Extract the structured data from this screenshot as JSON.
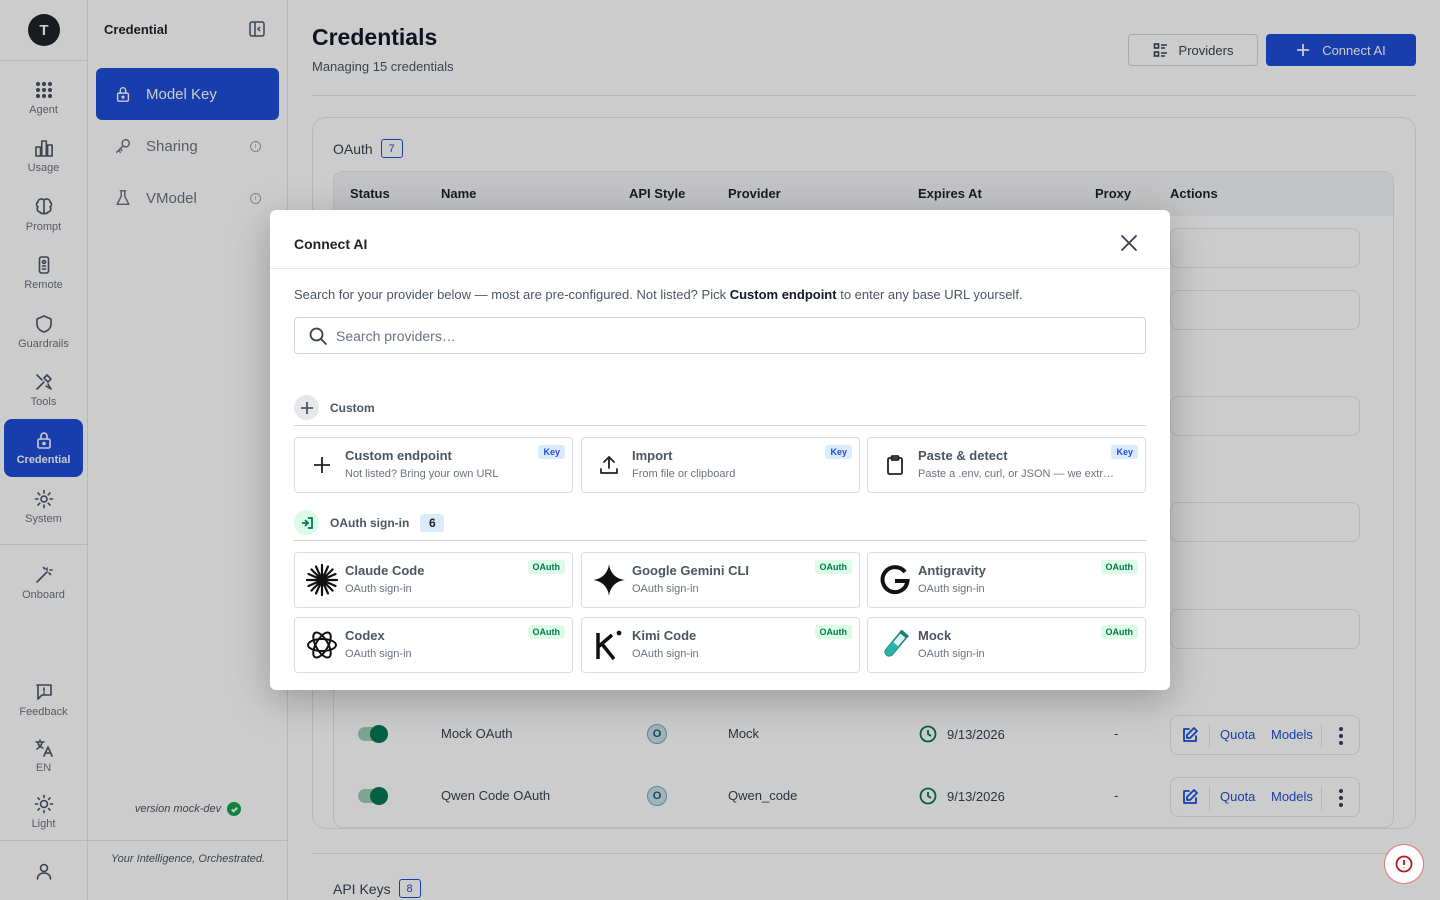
{
  "app": {
    "logo_letter": "T"
  },
  "rail": {
    "items": [
      {
        "label": "Agent",
        "icon": "agent-grid-icon"
      },
      {
        "label": "Usage",
        "icon": "bar-chart-icon"
      },
      {
        "label": "Prompt",
        "icon": "brain-icon"
      },
      {
        "label": "Remote",
        "icon": "remote-icon"
      },
      {
        "label": "Guardrails",
        "icon": "shield-icon"
      },
      {
        "label": "Tools",
        "icon": "tools-icon"
      },
      {
        "label": "Credential",
        "icon": "lock-icon",
        "active": true
      },
      {
        "label": "System",
        "icon": "gear-icon"
      },
      {
        "label": "Onboard",
        "icon": "magic-wand-icon"
      }
    ],
    "bottom": [
      {
        "label": "Feedback",
        "icon": "feedback-icon"
      },
      {
        "label": "EN",
        "icon": "translate-icon"
      },
      {
        "label": "Light",
        "icon": "sun-icon"
      }
    ]
  },
  "sidebar": {
    "title": "Credential",
    "items": [
      {
        "label": "Model Key",
        "icon": "lock-icon",
        "active": true
      },
      {
        "label": "Sharing",
        "icon": "key-icon"
      },
      {
        "label": "VModel",
        "icon": "flask-icon"
      }
    ],
    "version": "version mock-dev",
    "tagline": "Your Intelligence, Orchestrated."
  },
  "main": {
    "title": "Credentials",
    "subtitle": "Managing 15 credentials",
    "providers_label": "Providers",
    "connect_label": "Connect AI",
    "oauth_section": {
      "label": "OAuth",
      "count": "7"
    },
    "api_section": {
      "label": "API Keys",
      "count": "8"
    },
    "columns": [
      "Status",
      "Name",
      "API Style",
      "Provider",
      "Expires At",
      "Proxy",
      "Actions"
    ],
    "rows": [
      {
        "name": "Mock OAuth",
        "api_style": "O",
        "provider": "Mock",
        "expires": "9/13/2026",
        "proxy": "-"
      },
      {
        "name": "Qwen Code OAuth",
        "api_style": "O",
        "provider": "Qwen_code",
        "expires": "9/13/2026",
        "proxy": "-"
      }
    ],
    "action_labels": {
      "quota": "Quota",
      "models": "Models"
    }
  },
  "modal": {
    "title": "Connect AI",
    "desc_prefix": "Search for your provider below — most are pre-configured. Not listed? Pick ",
    "desc_bold": "Custom endpoint",
    "desc_suffix": " to enter any base URL yourself.",
    "search_placeholder": "Search providers…",
    "custom_group": {
      "label": "Custom",
      "cards": [
        {
          "name": "Custom endpoint",
          "sub": "Not listed? Bring your own URL",
          "badge": "Key",
          "icon": "plus-icon"
        },
        {
          "name": "Import",
          "sub": "From file or clipboard",
          "badge": "Key",
          "icon": "upload-icon"
        },
        {
          "name": "Paste & detect",
          "sub": "Paste a .env, curl, or JSON — we extract the key",
          "badge": "Key",
          "icon": "clipboard-icon"
        }
      ]
    },
    "oauth_group": {
      "label": "OAuth sign-in",
      "count": "6",
      "cards": [
        {
          "name": "Claude Code",
          "sub": "OAuth sign-in",
          "badge": "OAuth",
          "icon": "claude-logo-icon"
        },
        {
          "name": "Google Gemini CLI",
          "sub": "OAuth sign-in",
          "badge": "OAuth",
          "icon": "gemini-logo-icon"
        },
        {
          "name": "Antigravity",
          "sub": "OAuth sign-in",
          "badge": "OAuth",
          "icon": "google-g-icon"
        },
        {
          "name": "Codex",
          "sub": "OAuth sign-in",
          "badge": "OAuth",
          "icon": "openai-logo-icon"
        },
        {
          "name": "Kimi Code",
          "sub": "OAuth sign-in",
          "badge": "OAuth",
          "icon": "kimi-logo-icon"
        },
        {
          "name": "Mock",
          "sub": "OAuth sign-in",
          "badge": "OAuth",
          "icon": "test-tube-icon"
        }
      ]
    }
  },
  "colors": {
    "accent": "#1d4ed8",
    "success": "#047857",
    "danger": "#b91c1c"
  }
}
